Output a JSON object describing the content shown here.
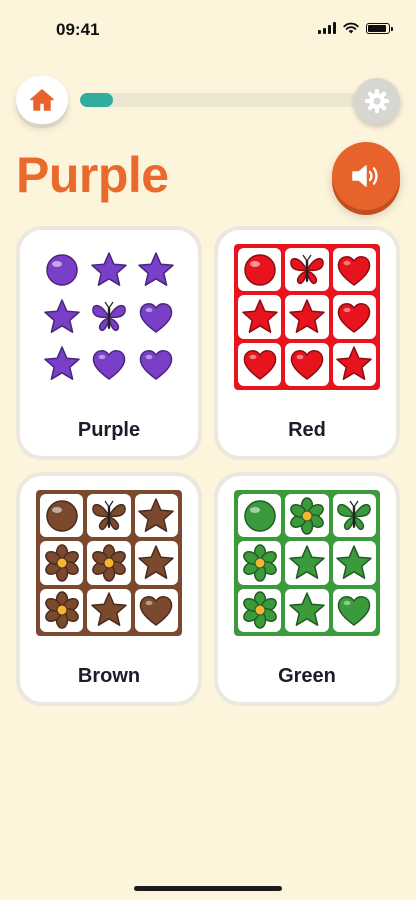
{
  "status": {
    "time": "09:41",
    "battery_level": 0.9
  },
  "progress": {
    "value": 0.11
  },
  "page": {
    "title": "Purple"
  },
  "colors": {
    "accent": "#e86a2c",
    "progress": "#30ada0"
  },
  "options": [
    {
      "label": "Purple",
      "color": "#7a3fc9",
      "frame": "none",
      "tile_bg": "transparent",
      "items": [
        "ball-icon",
        "star-icon",
        "star-icon",
        "star-icon",
        "butterfly-icon",
        "heart-icon",
        "star-icon",
        "heart-icon",
        "heart-icon"
      ]
    },
    {
      "label": "Red",
      "color": "#e8141d",
      "frame": "#e8141d",
      "tile_bg": "#ffffff",
      "items": [
        "ball-icon",
        "butterfly-icon",
        "heart-icon",
        "star-icon",
        "star-icon",
        "heart-icon",
        "heart-icon",
        "heart-icon",
        "star-icon"
      ]
    },
    {
      "label": "Brown",
      "color": "#7b4a2e",
      "frame": "#7b4a2e",
      "tile_bg": "#ffffff",
      "items": [
        "ball-icon",
        "butterfly-icon",
        "star-icon",
        "flower-icon",
        "flower-icon",
        "star-icon",
        "flower-icon",
        "star-icon",
        "heart-icon"
      ]
    },
    {
      "label": "Green",
      "color": "#3b9a3b",
      "frame": "#3b9a3b",
      "tile_bg": "#ffffff",
      "items": [
        "ball-icon",
        "flower-icon",
        "butterfly-icon",
        "flower-icon",
        "star-icon",
        "star-icon",
        "flower-icon",
        "star-icon",
        "heart-icon"
      ]
    }
  ]
}
